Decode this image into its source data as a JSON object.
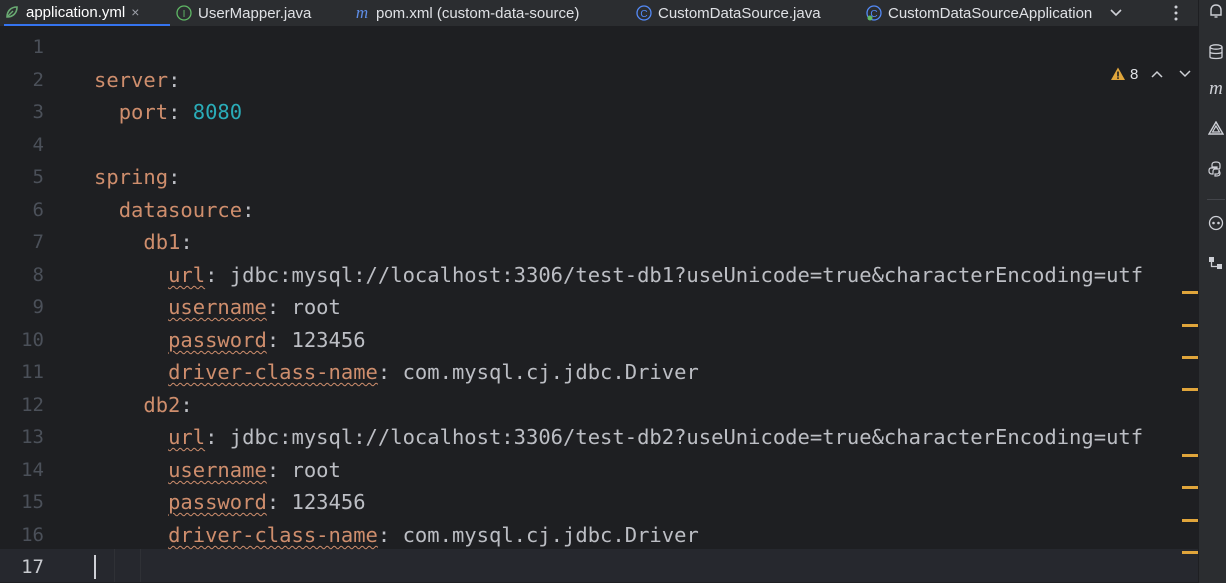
{
  "tabs": [
    {
      "label": "application.yml",
      "icon": "yaml-icon",
      "active": true,
      "closable": true
    },
    {
      "label": "UserMapper.java",
      "icon": "interface-icon"
    },
    {
      "label": "pom.xml (custom-data-source)",
      "icon": "maven-icon"
    },
    {
      "label": "CustomDataSource.java",
      "icon": "class-icon"
    },
    {
      "label": "CustomDataSourceApplication",
      "icon": "spring-class-icon"
    }
  ],
  "tab_close_glyph": "×",
  "tab_icon_glyphs": {
    "interface": "I",
    "maven": "m",
    "class": "C",
    "spring": "C"
  },
  "inspection": {
    "warnings": "8"
  },
  "line_numbers": [
    "1",
    "2",
    "3",
    "4",
    "5",
    "6",
    "7",
    "8",
    "9",
    "10",
    "11",
    "12",
    "13",
    "14",
    "15",
    "16",
    "17"
  ],
  "code": {
    "l2": {
      "key": "server",
      "colon": ":"
    },
    "l3": {
      "key": "port",
      "colon": ": ",
      "value": "8080"
    },
    "l5": {
      "key": "spring",
      "colon": ":"
    },
    "l6": {
      "key": "datasource",
      "colon": ":"
    },
    "l7": {
      "key": "db1",
      "colon": ":"
    },
    "l8": {
      "key": "url",
      "colon": ": ",
      "value": "jdbc:mysql://localhost:3306/test-db1?useUnicode=true&characterEncoding=utf"
    },
    "l9": {
      "key": "username",
      "colon": ": ",
      "value": "root"
    },
    "l10": {
      "key": "password",
      "colon": ": ",
      "value": "123456"
    },
    "l11": {
      "key": "driver-class-name",
      "colon": ": ",
      "value": "com.mysql.cj.jdbc.Driver"
    },
    "l12": {
      "key": "db2",
      "colon": ":"
    },
    "l13": {
      "key": "url",
      "colon": ": ",
      "value": "jdbc:mysql://localhost:3306/test-db2?useUnicode=true&characterEncoding=utf"
    },
    "l14": {
      "key": "username",
      "colon": ": ",
      "value": "root"
    },
    "l15": {
      "key": "password",
      "colon": ": ",
      "value": "123456"
    },
    "l16": {
      "key": "driver-class-name",
      "colon": ": ",
      "value": "com.mysql.cj.jdbc.Driver"
    }
  },
  "right_toolbar": {
    "maven_glyph": "m"
  },
  "colors": {
    "key": "#cf8e6d",
    "number": "#2aacb8",
    "warning": "#e0a53b",
    "active_tab_accent": "#3574f0"
  }
}
